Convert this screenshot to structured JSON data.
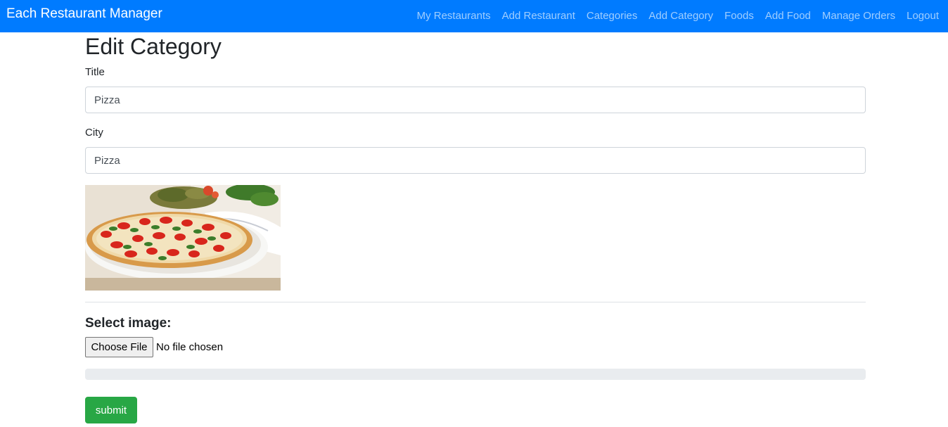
{
  "navbar": {
    "brand": "Each Restaurant Manager",
    "items": [
      "My Restaurants",
      "Add Restaurant",
      "Categories",
      "Add Category",
      "Foods",
      "Add Food",
      "Manage Orders",
      "Logout"
    ],
    "color": "#007bff"
  },
  "page": {
    "title": "Edit Category"
  },
  "form": {
    "title_label": "Title",
    "title_value": "Pizza",
    "city_label": "City",
    "city_value": "Pizza",
    "select_image_label": "Select image:",
    "file_button_label": "Choose File",
    "file_status": "No file chosen",
    "upload_progress": 0,
    "submit_label": "submit",
    "submit_color": "#28a745"
  }
}
